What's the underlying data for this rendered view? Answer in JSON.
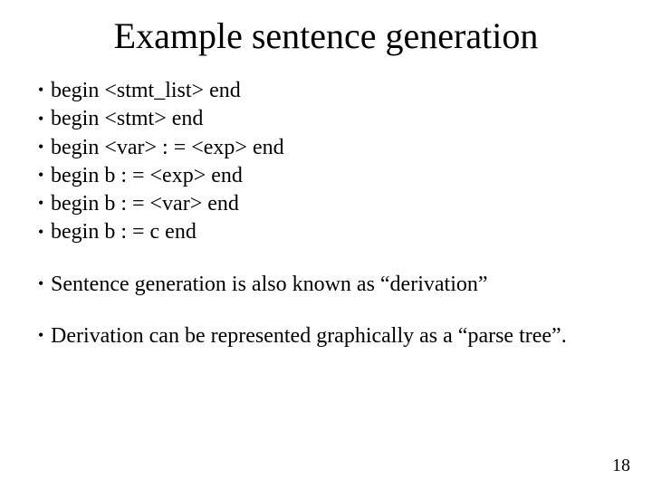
{
  "title": "Example sentence generation",
  "bullets_group1": [
    "begin <stmt_list> end",
    "begin <stmt> end",
    "begin <var> : = <exp> end",
    "begin b : = <exp> end",
    "begin b : = <var> end",
    "begin b : = c end"
  ],
  "bullets_group2": [
    "Sentence generation is also known as “derivation”"
  ],
  "bullets_group3": [
    "Derivation can be represented graphically as a “parse tree”."
  ],
  "page_number": "18"
}
